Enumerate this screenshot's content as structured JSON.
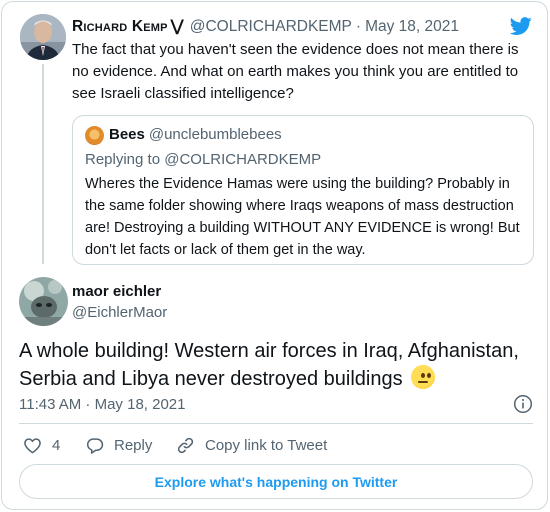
{
  "parent_tweet": {
    "name": "Richard Kemp",
    "verified_mark": "⋁",
    "handle": "@COLRICHARDKEMP",
    "separator": "·",
    "date": "May 18, 2021",
    "text": "The fact that you haven't seen the evidence does not mean there is no evidence. And what on earth makes you think you are entitled to see Israeli classified intelligence?"
  },
  "quoted_tweet": {
    "name": "Bees",
    "handle": "@unclebumblebees",
    "replying_to": "Replying to @COLRICHARDKEMP",
    "text": "Wheres the Evidence Hamas were using the building? Probably in the same folder showing where Iraqs weapons of mass destruction are! Destroying a building WITHOUT ANY EVIDENCE is wrong! But don't let facts or lack of them get in the way."
  },
  "main_tweet": {
    "name": "maor eichler",
    "handle": "@EichlerMaor",
    "text": "A whole building! Western air forces in Iraq, Afghanistan, Serbia and Libya never destroyed buildings",
    "emoji_icon": "face-with-rolling-eyes",
    "timestamp": "11:43 AM · May 18, 2021"
  },
  "actions": {
    "like_count": "4",
    "reply_label": "Reply",
    "copy_link_label": "Copy link to Tweet"
  },
  "explore_label": "Explore what's happening on Twitter",
  "colors": {
    "accent": "#1d9bf0",
    "secondary_text": "#536471",
    "border": "#cfd9de"
  }
}
